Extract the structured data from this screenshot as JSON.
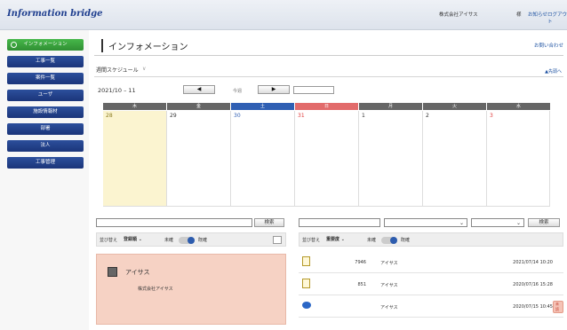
{
  "header": {
    "logo": "Information bridge",
    "company": "株式会社アイサス",
    "sama": "様",
    "links": [
      "お知らせ",
      "ログアウト"
    ]
  },
  "sidebar": {
    "items": [
      {
        "label": "インフォメーション",
        "active": true
      },
      {
        "label": "工事一覧"
      },
      {
        "label": "案件一覧"
      },
      {
        "label": "ユーザ"
      },
      {
        "label": "施設情報材"
      },
      {
        "label": "部署"
      },
      {
        "label": "法人"
      },
      {
        "label": "工事管理"
      }
    ]
  },
  "main": {
    "title": "インフォメーション",
    "inquiry": "お問い合わせ",
    "schedule_label": "週間スケジュール",
    "chevron": "∨",
    "to_top": "▲先頭へ",
    "date_range": "2021/10 – 11",
    "prev": "◀",
    "next": "▶",
    "today": "今週"
  },
  "calendar": {
    "headers": [
      "木",
      "金",
      "土",
      "日",
      "月",
      "火",
      "水"
    ],
    "days": [
      "28",
      "29",
      "30",
      "31",
      "1",
      "2",
      "3"
    ]
  },
  "search": {
    "button": "検索",
    "select_arrow": "⌄"
  },
  "left_filter": {
    "sort_label": "並び替え",
    "sort_value": "登録順 ⌄",
    "unread": "未確",
    "read": "既確"
  },
  "right_filter": {
    "sort_label": "並び替え",
    "sort_value": "重要度 ⌄",
    "unread": "未確",
    "read": "既確"
  },
  "card": {
    "name": "アイサス",
    "company": "株式会社アイサス"
  },
  "messages": [
    {
      "icon": "document-icon",
      "num": "7946",
      "name": "アイサス",
      "time": "2021/07/14 10:20"
    },
    {
      "icon": "document-icon",
      "num": "851",
      "name": "アイサス",
      "time": "2020/07/16 15:28"
    },
    {
      "icon": "chat-icon",
      "num": "",
      "name": "アイサス",
      "time": "2020/07/15 10:45",
      "badge": "未読"
    }
  ]
}
